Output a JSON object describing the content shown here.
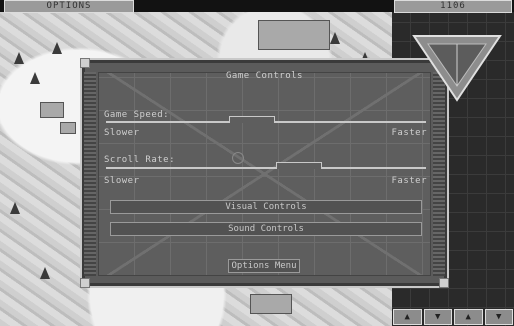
{
  "topbar": {
    "options_tab": "OPTIONS",
    "credits": "1106"
  },
  "dialog": {
    "title": "Game Controls",
    "game_speed": {
      "label": "Game Speed:",
      "min_label": "Slower",
      "max_label": "Faster",
      "value": 0.45
    },
    "scroll_rate": {
      "label": "Scroll Rate:",
      "min_label": "Slower",
      "max_label": "Faster",
      "value": 0.62
    },
    "buttons": {
      "visual": "Visual Controls",
      "sound": "Sound Controls",
      "options_menu": "Options Menu"
    }
  },
  "colors": {
    "panel": "#5e5e5e",
    "text": "#cfcfcf",
    "snow": "#e6e6e6"
  }
}
